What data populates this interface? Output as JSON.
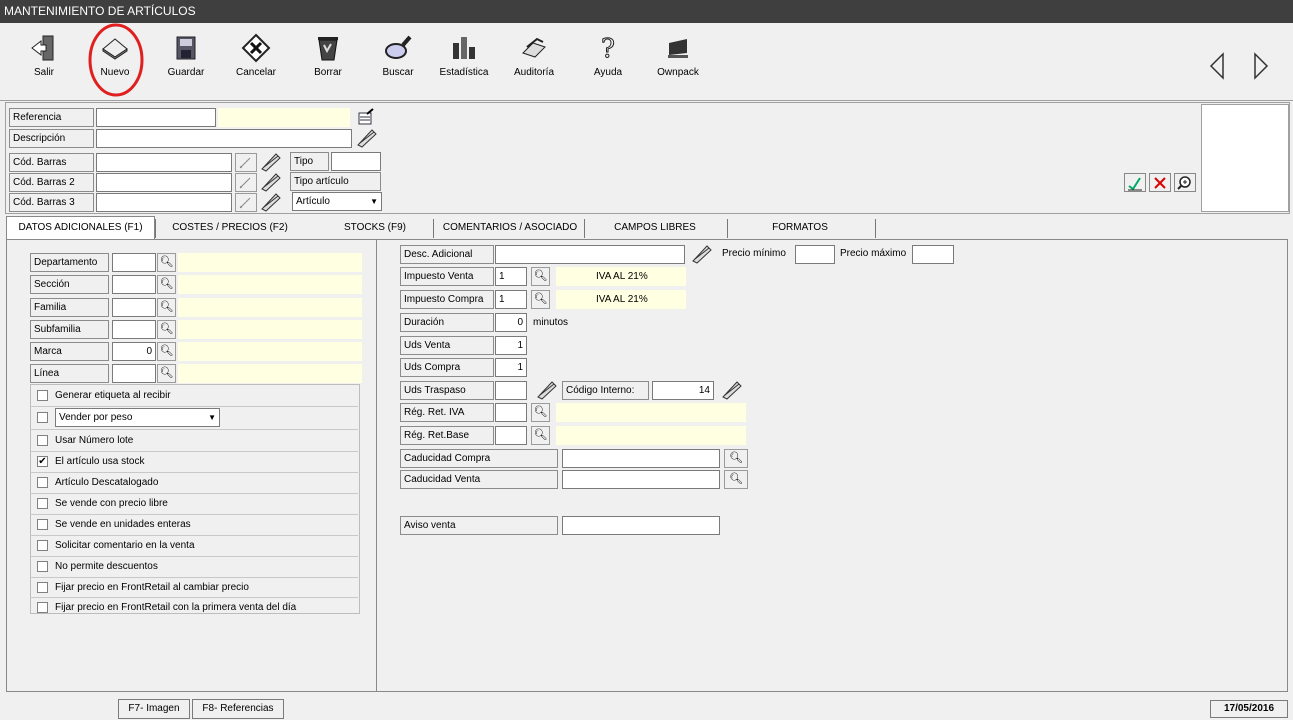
{
  "window": {
    "title": "MANTENIMIENTO DE ARTÍCULOS"
  },
  "toolbar": {
    "salir": "Salir",
    "nuevo": "Nuevo",
    "guardar": "Guardar",
    "cancelar": "Cancelar",
    "borrar": "Borrar",
    "buscar": "Buscar",
    "estadistica": "Estadística",
    "auditoria": "Auditoría",
    "ayuda": "Ayuda",
    "ownpack": "Ownpack"
  },
  "header": {
    "referencia_label": "Referencia",
    "referencia_value": "",
    "descripcion_label": "Descripción",
    "descripcion_value": "",
    "cod_barras_label": "Cód. Barras",
    "cod_barras_value": "",
    "cod_barras2_label": "Cód. Barras 2",
    "cod_barras2_value": "",
    "cod_barras3_label": "Cód. Barras 3",
    "cod_barras3_value": "",
    "tipo_label": "Tipo",
    "tipo_value": "",
    "tipo_articulo_label": "Tipo artículo",
    "tipo_articulo_value": "Artículo"
  },
  "tabs": {
    "t1": "DATOS ADICIONALES (F1)",
    "t2": "COSTES / PRECIOS (F2)",
    "t3": "STOCKS (F9)",
    "t4": "COMENTARIOS / ASOCIADO",
    "t5": "CAMPOS LIBRES",
    "t6": "FORMATOS"
  },
  "left": {
    "departamento": "Departamento",
    "seccion": "Sección",
    "familia": "Familia",
    "subfamilia": "Subfamilia",
    "marca": "Marca",
    "marca_value": "0",
    "linea": "Línea"
  },
  "checks": {
    "c1": "Generar etiqueta al recibir",
    "c2_select": "Vender por peso",
    "c3": "Usar Número lote",
    "c4": "El artículo usa stock",
    "c4_mark": "✔",
    "c5": "Artículo Descatalogado",
    "c6": "Se vende con precio libre",
    "c7": "Se vende en unidades enteras",
    "c8": "Solicitar comentario en la venta",
    "c9": "No permite descuentos",
    "c10": "Fijar precio en FrontRetail al cambiar precio",
    "c11": "Fijar precio en FrontRetail con la primera venta del día"
  },
  "right": {
    "desc_adicional": "Desc. Adicional",
    "precio_minimo": "Precio mínimo",
    "precio_maximo": "Precio máximo",
    "impuesto_venta": "Impuesto Venta",
    "impuesto_venta_value": "1",
    "impuesto_venta_desc": "IVA AL 21%",
    "impuesto_compra": "Impuesto Compra",
    "impuesto_compra_value": "1",
    "impuesto_compra_desc": "IVA AL 21%",
    "duracion": "Duración",
    "duracion_value": "0",
    "minutos": "minutos",
    "uds_venta": "Uds Venta",
    "uds_venta_value": "1",
    "uds_compra": "Uds Compra",
    "uds_compra_value": "1",
    "uds_traspaso": "Uds Traspaso",
    "codigo_interno": "Código Interno:",
    "codigo_interno_value": "14",
    "reg_ret_iva": "Rég. Ret. IVA",
    "reg_ret_base": "Rég. Ret.Base",
    "caducidad_compra": "Caducidad Compra",
    "caducidad_venta": "Caducidad Venta",
    "aviso_venta": "Aviso venta"
  },
  "footer": {
    "f7": "F7- Imagen",
    "f8": "F8- Referencias",
    "date": "17/05/2016"
  },
  "colors": {
    "highlight_circle": "#e02020",
    "field_yellow": "#ffffe1"
  }
}
